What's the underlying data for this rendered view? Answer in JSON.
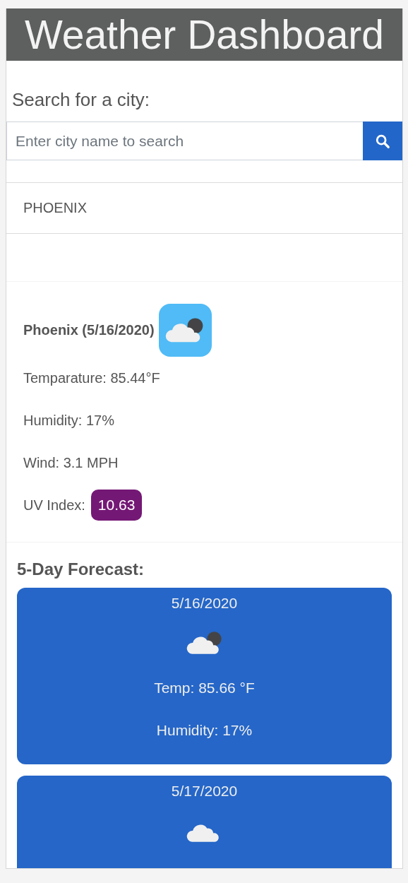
{
  "header": {
    "title": "Weather Dashboard"
  },
  "search": {
    "label": "Search for a city:",
    "placeholder": "Enter city name to search"
  },
  "history": [
    {
      "city": "PHOENIX"
    }
  ],
  "current": {
    "title": "Phoenix (5/16/2020)",
    "kind": "partly-cloudy-night",
    "temperature": "Temparature: 85.44°F",
    "humidity": "Humidity: 17%",
    "wind": "Wind: 3.1 MPH",
    "uv": {
      "label": "UV Index:",
      "value": "10.63",
      "color": "#741875"
    }
  },
  "forecast_title": "5-Day Forecast:",
  "forecast": [
    {
      "date": "5/16/2020",
      "kind": "partly-cloudy-night",
      "temp": "Temp: 85.66 °F",
      "humidity": "Humidity: 17%"
    },
    {
      "date": "5/17/2020",
      "kind": "cloudy"
    }
  ]
}
